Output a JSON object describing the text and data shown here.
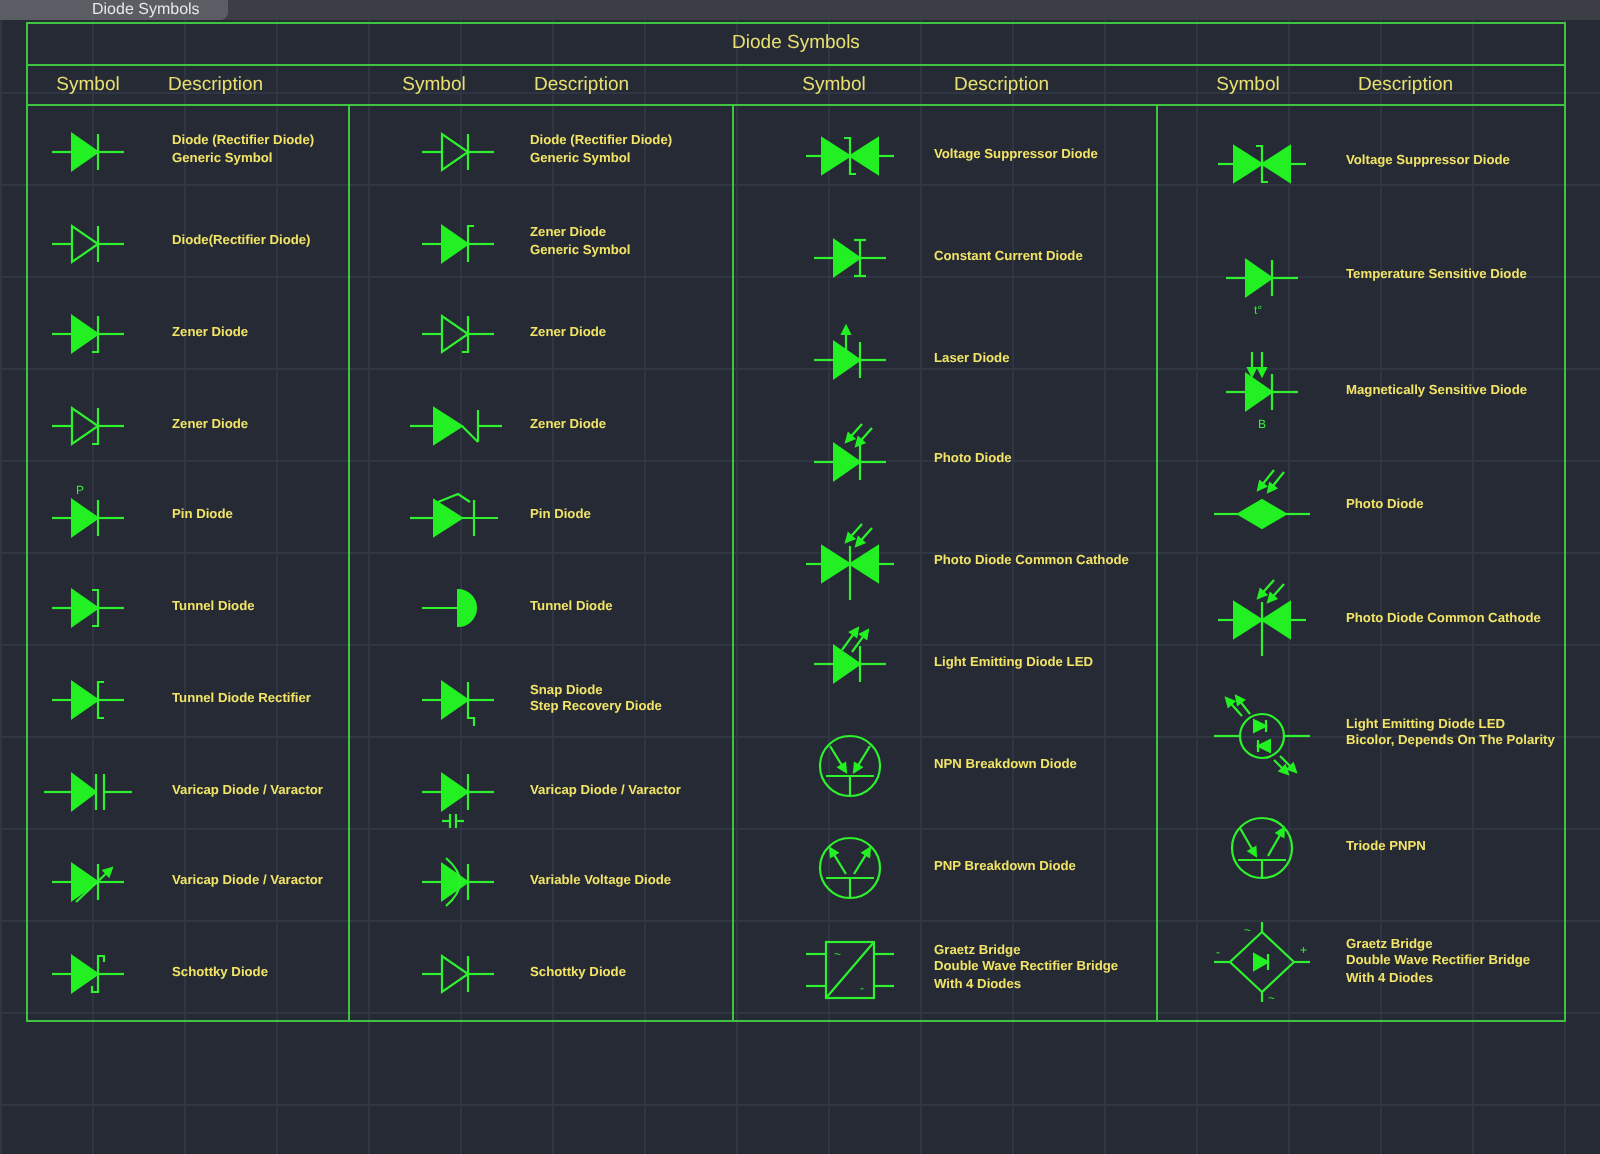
{
  "tab": {
    "title": "Diode Symbols"
  },
  "sheet": {
    "title": "Diode Symbols",
    "columns": [
      {
        "symbol_header": "Symbol",
        "description_header": "Description",
        "rows": [
          {
            "kind": "diode",
            "description": [
              "Diode (Rectifier Diode)",
              "Generic Symbol"
            ]
          },
          {
            "kind": "diode-outline",
            "description": [
              "Diode(Rectifier Diode)"
            ]
          },
          {
            "kind": "zener",
            "description": [
              "Zener Diode"
            ]
          },
          {
            "kind": "zener-outline",
            "description": [
              "Zener Diode"
            ]
          },
          {
            "kind": "pin",
            "marks": [
              "P"
            ],
            "description": [
              "Pin Diode"
            ]
          },
          {
            "kind": "tunnel",
            "description": [
              "Tunnel Diode"
            ]
          },
          {
            "kind": "tunnel-rectifier",
            "description": [
              "Tunnel Diode Rectifier"
            ]
          },
          {
            "kind": "varicap",
            "description": [
              "Varicap Diode / Varactor"
            ]
          },
          {
            "kind": "varicap-arrow",
            "description": [
              "Varicap Diode / Varactor"
            ]
          },
          {
            "kind": "schottky",
            "description": [
              "Schottky Diode"
            ]
          }
        ]
      },
      {
        "symbol_header": "Symbol",
        "description_header": "Description",
        "rows": [
          {
            "kind": "diode-outline",
            "description": [
              "Diode (Rectifier Diode)",
              "Generic Symbol"
            ]
          },
          {
            "kind": "zener-flag",
            "description": [
              "Zener Diode",
              "Generic Symbol"
            ]
          },
          {
            "kind": "zener-outline",
            "description": [
              "Zener Diode"
            ]
          },
          {
            "kind": "zener-long",
            "description": [
              "Zener Diode"
            ]
          },
          {
            "kind": "pin-long",
            "description": [
              "Pin Diode"
            ]
          },
          {
            "kind": "tunnel-half",
            "description": [
              "Tunnel Diode"
            ]
          },
          {
            "kind": "snap",
            "description": [
              "Snap Diode",
              "Step Recovery Diode"
            ]
          },
          {
            "kind": "varicap-cap",
            "description": [
              "Varicap Diode / Varactor"
            ]
          },
          {
            "kind": "variable-voltage",
            "description": [
              "Variable Voltage Diode"
            ]
          },
          {
            "kind": "diode-outline",
            "description": [
              "Schottky Diode"
            ]
          }
        ]
      },
      {
        "symbol_header": "Symbol",
        "description_header": "Description",
        "rows": [
          {
            "kind": "suppressor",
            "description": [
              "Voltage Suppressor Diode"
            ]
          },
          {
            "kind": "constant-current",
            "description": [
              "Constant Current Diode"
            ]
          },
          {
            "kind": "laser",
            "description": [
              "Laser Diode"
            ]
          },
          {
            "kind": "photo",
            "description": [
              "Photo Diode"
            ]
          },
          {
            "kind": "photo-common",
            "description": [
              "Photo Diode Common Cathode"
            ]
          },
          {
            "kind": "led",
            "description": [
              "Light Emitting Diode LED"
            ]
          },
          {
            "kind": "npn",
            "description": [
              "NPN Breakdown Diode"
            ]
          },
          {
            "kind": "pnp",
            "description": [
              "PNP Breakdown Diode"
            ]
          },
          {
            "kind": "bridge-square",
            "marks": [
              "~",
              "-"
            ],
            "description": [
              "Graetz Bridge",
              "Double Wave Rectifier Bridge",
              "With 4 Diodes"
            ]
          }
        ]
      },
      {
        "symbol_header": "Symbol",
        "description_header": "Description",
        "rows": [
          {
            "kind": "suppressor",
            "description": [
              "Voltage Suppressor Diode"
            ]
          },
          {
            "kind": "temperature",
            "marks": [
              "t°"
            ],
            "description": [
              "Temperature Sensitive Diode"
            ]
          },
          {
            "kind": "magnetic",
            "marks": [
              "B"
            ],
            "description": [
              "Magnetically Sensitive Diode"
            ]
          },
          {
            "kind": "photo-diamond",
            "description": [
              "Photo Diode"
            ]
          },
          {
            "kind": "photo-common",
            "description": [
              "Photo Diode Common Cathode"
            ]
          },
          {
            "kind": "led-bicolor",
            "description": [
              "Light Emitting Diode LED",
              "Bicolor, Depends On The Polarity"
            ]
          },
          {
            "kind": "triode",
            "description": [
              "Triode PNPN"
            ]
          },
          {
            "kind": "bridge-diamond",
            "marks": [
              "~",
              "+",
              "~",
              "-"
            ],
            "description": [
              "Graetz Bridge",
              "Double Wave Rectifier Bridge",
              "With 4 Diodes"
            ]
          }
        ]
      }
    ]
  }
}
